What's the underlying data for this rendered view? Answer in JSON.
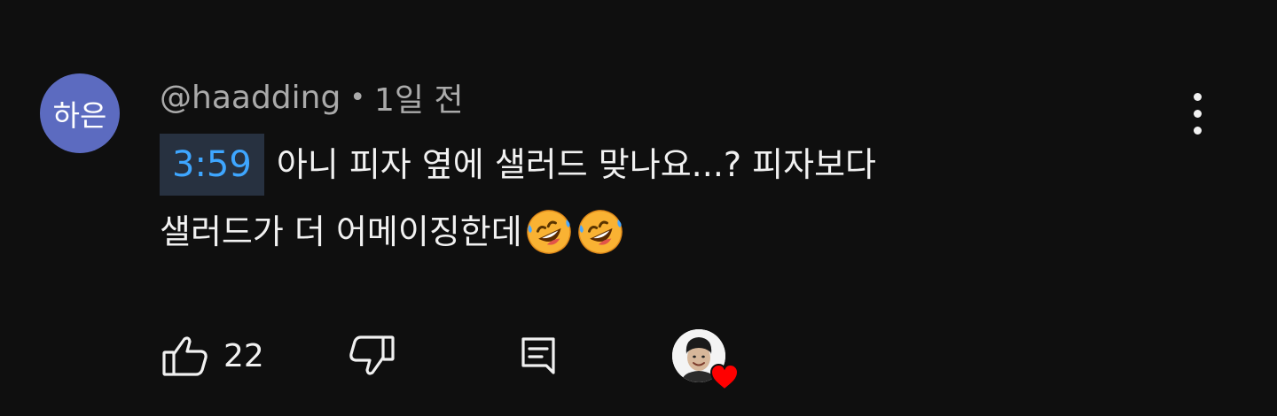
{
  "comment": {
    "avatar_text": "하은",
    "author": "@haadding",
    "separator": "•",
    "time_ago": "1일 전",
    "timestamp_link": "3:59",
    "text_line1": "아니 피자 옆에 샐러드 맞나요...? 피자보다",
    "text_line2": "샐러드가 더 어메이징한데",
    "emoji": "rolling-on-the-floor-laughing",
    "emoji_count": 2
  },
  "actions": {
    "like_count": "22",
    "like_icon": "thumb-up-icon",
    "dislike_icon": "thumb-down-icon",
    "reply_icon": "reply-icon",
    "creator_heart": "heart-icon"
  },
  "colors": {
    "background": "#0f0f0f",
    "text": "#f1f1f1",
    "secondary_text": "#aaaaaa",
    "avatar_bg": "#5c6bc0",
    "timestamp_bg": "#273140",
    "timestamp_text": "#3ea6ff",
    "heart": "#ff0000"
  }
}
